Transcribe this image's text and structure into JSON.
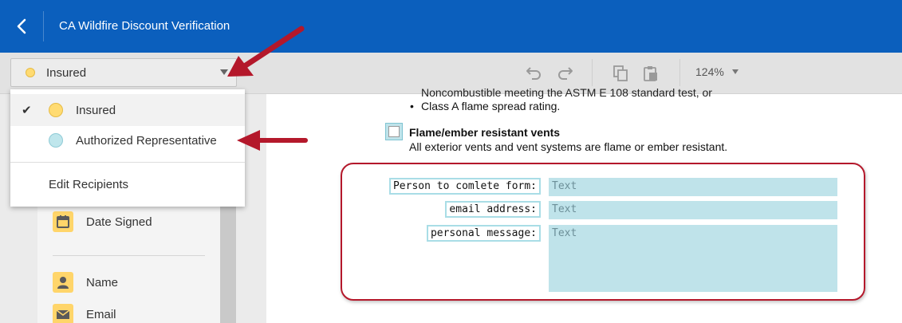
{
  "header": {
    "title": "CA Wildfire Discount Verification"
  },
  "toolbar": {
    "recipient": {
      "label": "Insured",
      "dot_color": "#ffdb72"
    },
    "zoom": "124%"
  },
  "menu": {
    "items": [
      {
        "label": "Insured",
        "selected": true,
        "dot_color": "#ffdb72"
      },
      {
        "label": "Authorized Representative",
        "selected": false,
        "dot_color": "#bfe6ec"
      }
    ],
    "edit": "Edit Recipients"
  },
  "palette": {
    "items": [
      {
        "label": "Date Signed",
        "icon": "calendar-icon"
      },
      {
        "label": "Name",
        "icon": "person-icon"
      },
      {
        "label": "Email",
        "icon": "envelope-icon"
      }
    ]
  },
  "document": {
    "clipped_line": "Noncombustible meeting the ASTM E 108 standard test, or",
    "bullet": "Class A flame spread rating.",
    "vents_title": "Flame/ember resistant vents",
    "vents_desc": "All exterior vents and vent systems are flame or ember resistant.",
    "fields": [
      {
        "label": "Person to comlete form:",
        "value": "Text"
      },
      {
        "label": "email address:",
        "value": "Text"
      },
      {
        "label": "personal message:",
        "value": "Text"
      }
    ]
  }
}
